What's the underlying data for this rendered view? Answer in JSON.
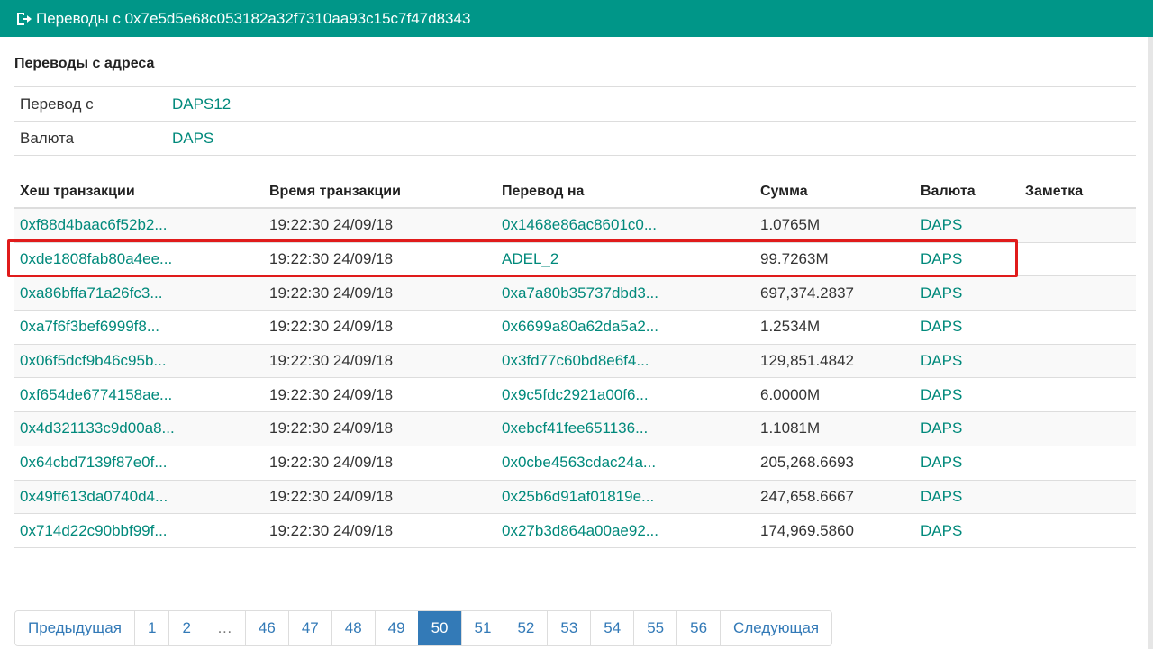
{
  "header": {
    "title": "Переводы с 0x7e5d5e68c053182a32f7310aa93c15c7f47d8343",
    "icon": "sign-out-icon"
  },
  "section_title": "Переводы с адреса",
  "info": [
    {
      "label": "Перевод с",
      "value": "DAPS12"
    },
    {
      "label": "Валюта",
      "value": "DAPS"
    }
  ],
  "table": {
    "headers": [
      "Хеш транзакции",
      "Время транзакции",
      "Перевод на",
      "Сумма",
      "Валюта",
      "Заметка"
    ],
    "rows": [
      {
        "hash": "0xf88d4baac6f52b2...",
        "time": "19:22:30 24/09/18",
        "to": "0x1468e86ac8601c0...",
        "amount": "1.0765M",
        "currency": "DAPS",
        "note": ""
      },
      {
        "hash": "0xde1808fab80a4ee...",
        "time": "19:22:30 24/09/18",
        "to": "ADEL_2",
        "amount": "99.7263M",
        "currency": "DAPS",
        "note": ""
      },
      {
        "hash": "0xa86bffa71a26fc3...",
        "time": "19:22:30 24/09/18",
        "to": "0xa7a80b35737dbd3...",
        "amount": "697,374.2837",
        "currency": "DAPS",
        "note": ""
      },
      {
        "hash": "0xa7f6f3bef6999f8...",
        "time": "19:22:30 24/09/18",
        "to": "0x6699a80a62da5a2...",
        "amount": "1.2534M",
        "currency": "DAPS",
        "note": ""
      },
      {
        "hash": "0x06f5dcf9b46c95b...",
        "time": "19:22:30 24/09/18",
        "to": "0x3fd77c60bd8e6f4...",
        "amount": "129,851.4842",
        "currency": "DAPS",
        "note": ""
      },
      {
        "hash": "0xf654de6774158ae...",
        "time": "19:22:30 24/09/18",
        "to": "0x9c5fdc2921a00f6...",
        "amount": "6.0000M",
        "currency": "DAPS",
        "note": ""
      },
      {
        "hash": "0x4d321133c9d00a8...",
        "time": "19:22:30 24/09/18",
        "to": "0xebcf41fee651136...",
        "amount": "1.1081M",
        "currency": "DAPS",
        "note": ""
      },
      {
        "hash": "0x64cbd7139f87e0f...",
        "time": "19:22:30 24/09/18",
        "to": "0x0cbe4563cdac24a...",
        "amount": "205,268.6693",
        "currency": "DAPS",
        "note": ""
      },
      {
        "hash": "0x49ff613da0740d4...",
        "time": "19:22:30 24/09/18",
        "to": "0x25b6d91af01819e...",
        "amount": "247,658.6667",
        "currency": "DAPS",
        "note": ""
      },
      {
        "hash": "0x714d22c90bbf99f...",
        "time": "19:22:30 24/09/18",
        "to": "0x27b3d864a00ae92...",
        "amount": "174,969.5860",
        "currency": "DAPS",
        "note": ""
      }
    ]
  },
  "pagination": {
    "prev": "Предыдущая",
    "next": "Следующая",
    "pages": [
      "1",
      "2",
      "…",
      "46",
      "47",
      "48",
      "49",
      "50",
      "51",
      "52",
      "53",
      "54",
      "55",
      "56"
    ],
    "active": "50"
  },
  "colors": {
    "header_bg": "#009688",
    "link": "#00897b",
    "highlight": "#e01b1b",
    "pager_active": "#337ab7"
  }
}
